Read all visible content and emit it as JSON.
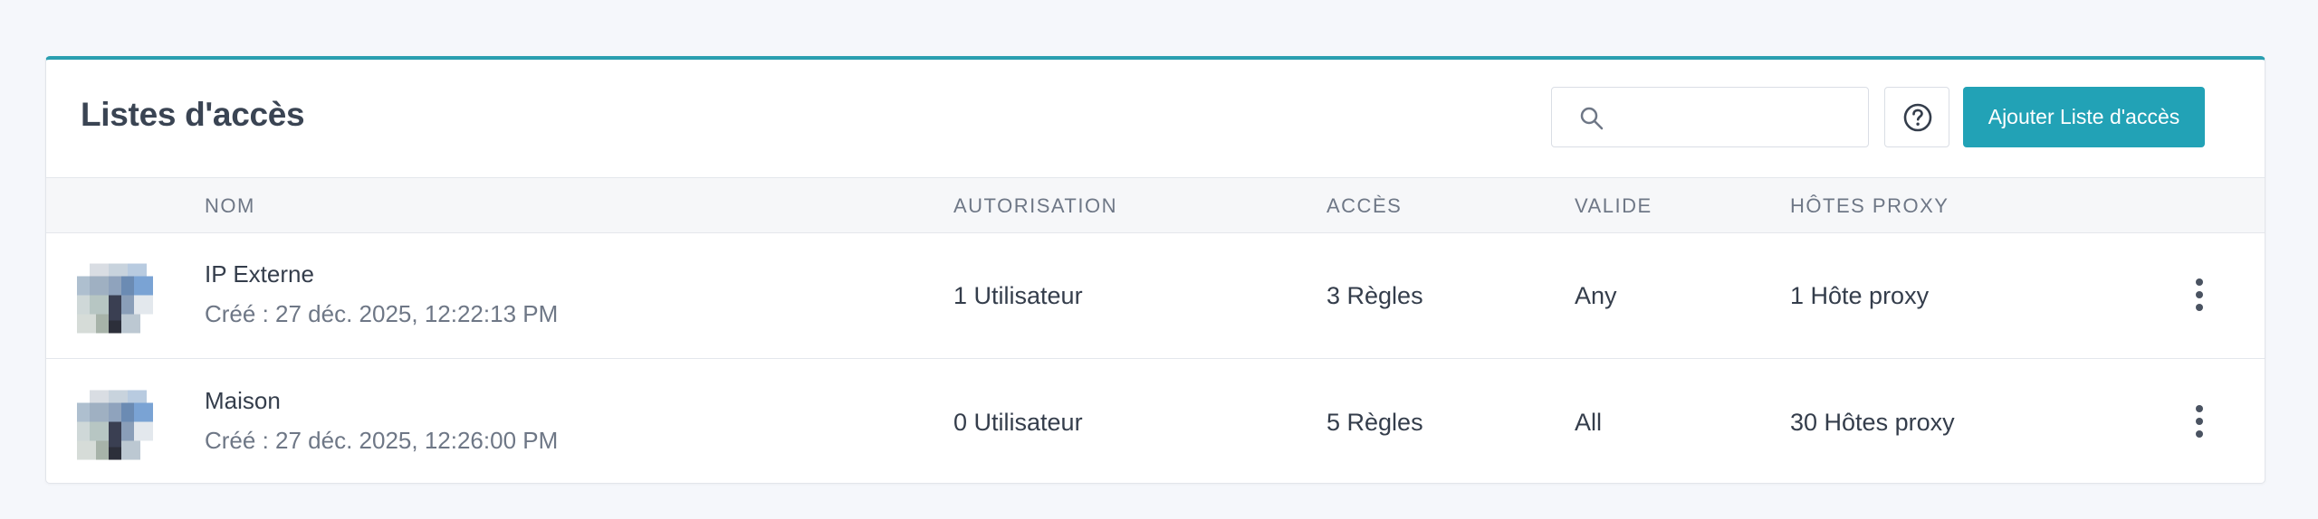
{
  "header": {
    "title": "Listes d'accès",
    "search": {
      "value": "",
      "placeholder": ""
    },
    "add_button_label": "Ajouter Liste d'accès",
    "search_icon": "search-icon",
    "help_icon": "help-circle-icon"
  },
  "table": {
    "columns": [
      "",
      "NOM",
      "AUTORISATION",
      "ACCÈS",
      "VALIDE",
      "HÔTES PROXY"
    ],
    "rows": [
      {
        "name": "IP Externe",
        "created": "Créé : 27 déc. 2025, 12:22:13 PM",
        "authorization": "1 Utilisateur",
        "access": "3 Règles",
        "valid": "Any",
        "proxy_hosts": "1 Hôte proxy"
      },
      {
        "name": "Maison",
        "created": "Créé : 27 déc. 2025, 12:26:00 PM",
        "authorization": "0 Utilisateur",
        "access": "5 Règles",
        "valid": "All",
        "proxy_hosts": "30 Hôtes proxy"
      }
    ]
  },
  "colors": {
    "accent": "#22a2b6",
    "card_border_top": "#2a9fb0",
    "background": "#f5f7fb"
  }
}
